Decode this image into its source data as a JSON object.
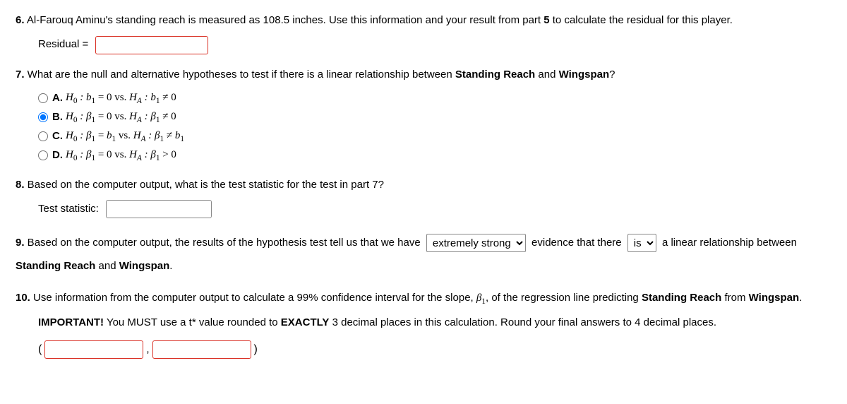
{
  "q6": {
    "number": "6.",
    "text_a": " Al-Farouq Aminu's standing reach is measured as 108.5 inches. Use this information and your result from part ",
    "part_ref": "5",
    "text_b": " to calculate the residual for this player.",
    "label": "Residual ="
  },
  "q7": {
    "number": "7.",
    "text_a": " What are the null and alternative hypotheses to test if there is a linear relationship between ",
    "bold1": "Standing Reach",
    "text_b": " and ",
    "bold2": "Wingspan",
    "text_c": "?",
    "options": {
      "a_letter": "A.",
      "a_math": "H₀ : b₁ = 0 vs. H_A : b₁ ≠ 0",
      "b_letter": "B.",
      "b_math": "H₀ : β₁ = 0 vs. H_A : β₁ ≠ 0",
      "c_letter": "C.",
      "c_math": "H₀ : β₁ = b₁ vs. H_A : β₁ ≠ b₁",
      "d_letter": "D.",
      "d_math": "H₀ : β₁ = 0 vs. H_A : β₁ > 0"
    }
  },
  "q8": {
    "number": "8.",
    "text": " Based on the computer output, what is the test statistic for the test in part 7?",
    "label": "Test statistic:"
  },
  "q9": {
    "number": "9.",
    "text_a": " Based on the computer output, the results of the hypothesis test tell us that we have ",
    "select1_value": "extremely strong",
    "text_b": " evidence that there ",
    "select2_value": "is",
    "text_c": " a linear relationship between ",
    "bold1": "Standing Reach",
    "text_d": " and ",
    "bold2": "Wingspan",
    "text_e": "."
  },
  "q10": {
    "number": "10.",
    "text_a": " Use information from the computer output to calculate a 99% confidence interval for the slope, ",
    "beta": "β₁",
    "text_b": ", of the regression line predicting ",
    "bold1": "Standing Reach",
    "text_c": " from ",
    "bold2": "Wingspan",
    "text_d": ".",
    "important_label": "IMPORTANT!",
    "important_a": " You MUST use a t* value rounded to ",
    "important_bold": "EXACTLY",
    "important_b": " 3 decimal places in this calculation. Round your final answers to 4 decimal places.",
    "open": "(",
    "comma": ",",
    "close": ")"
  }
}
